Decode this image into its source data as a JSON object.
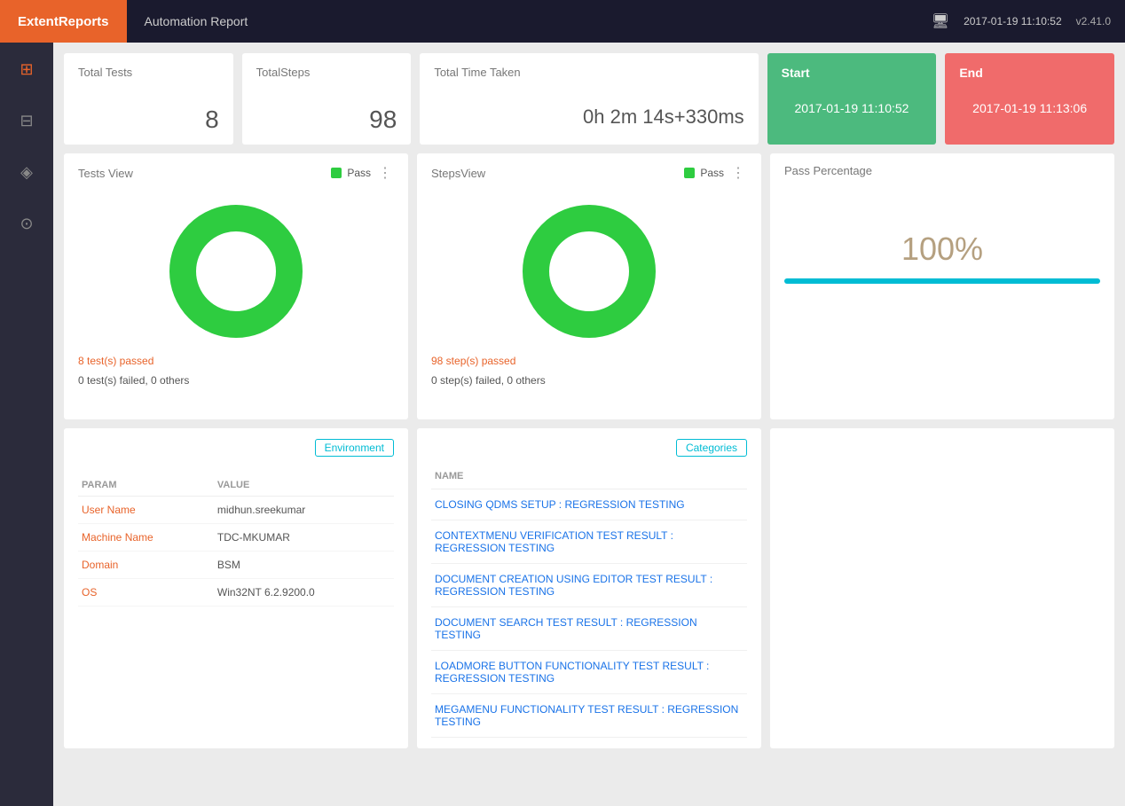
{
  "navbar": {
    "brand": "ExtentReports",
    "title": "Automation Report",
    "datetime": "2017-01-19 11:10:52",
    "version": "v2.41.0"
  },
  "stats": {
    "total_tests_label": "Total Tests",
    "total_tests_value": "8",
    "total_steps_label": "TotalSteps",
    "total_steps_value": "98",
    "total_time_label": "Total Time Taken",
    "total_time_value": "0h 2m 14s+330ms",
    "start_label": "Start",
    "start_value": "2017-01-19 11:10:52",
    "end_label": "End",
    "end_value": "2017-01-19 11:13:06"
  },
  "tests_view": {
    "title": "Tests View",
    "legend_label": "Pass",
    "passed_text": "8 test(s) passed",
    "failed_text": "0 test(s) failed, 0 others"
  },
  "steps_view": {
    "title": "StepsView",
    "legend_label": "Pass",
    "passed_text": "98 step(s) passed",
    "failed_text": "0 step(s) failed, 0 others"
  },
  "pass_percentage": {
    "title": "Pass Percentage",
    "value": "100%",
    "progress": 100
  },
  "environment": {
    "tag": "Environment",
    "param_col": "PARAM",
    "value_col": "VALUE",
    "rows": [
      {
        "param": "User Name",
        "value": "midhun.sreekumar"
      },
      {
        "param": "Machine Name",
        "value": "TDC-MKUMAR"
      },
      {
        "param": "Domain",
        "value": "BSM"
      },
      {
        "param": "OS",
        "value": "Win32NT 6.2.9200.0"
      }
    ]
  },
  "categories": {
    "tag": "Categories",
    "name_col": "NAME",
    "items": [
      "CLOSING QDMS SETUP : REGRESSION TESTING",
      "CONTEXTMENU VERIFICATION TEST RESULT : REGRESSION TESTING",
      "DOCUMENT CREATION USING EDITOR TEST RESULT : REGRESSION TESTING",
      "DOCUMENT SEARCH TEST RESULT : REGRESSION TESTING",
      "LOADMORE BUTTON FUNCTIONALITY TEST RESULT : REGRESSION TESTING",
      "MEGAMENU FUNCTIONALITY TEST RESULT : REGRESSION TESTING"
    ]
  },
  "sidebar": {
    "items": [
      "⊞",
      "⊟",
      "◈",
      "⊙"
    ]
  }
}
